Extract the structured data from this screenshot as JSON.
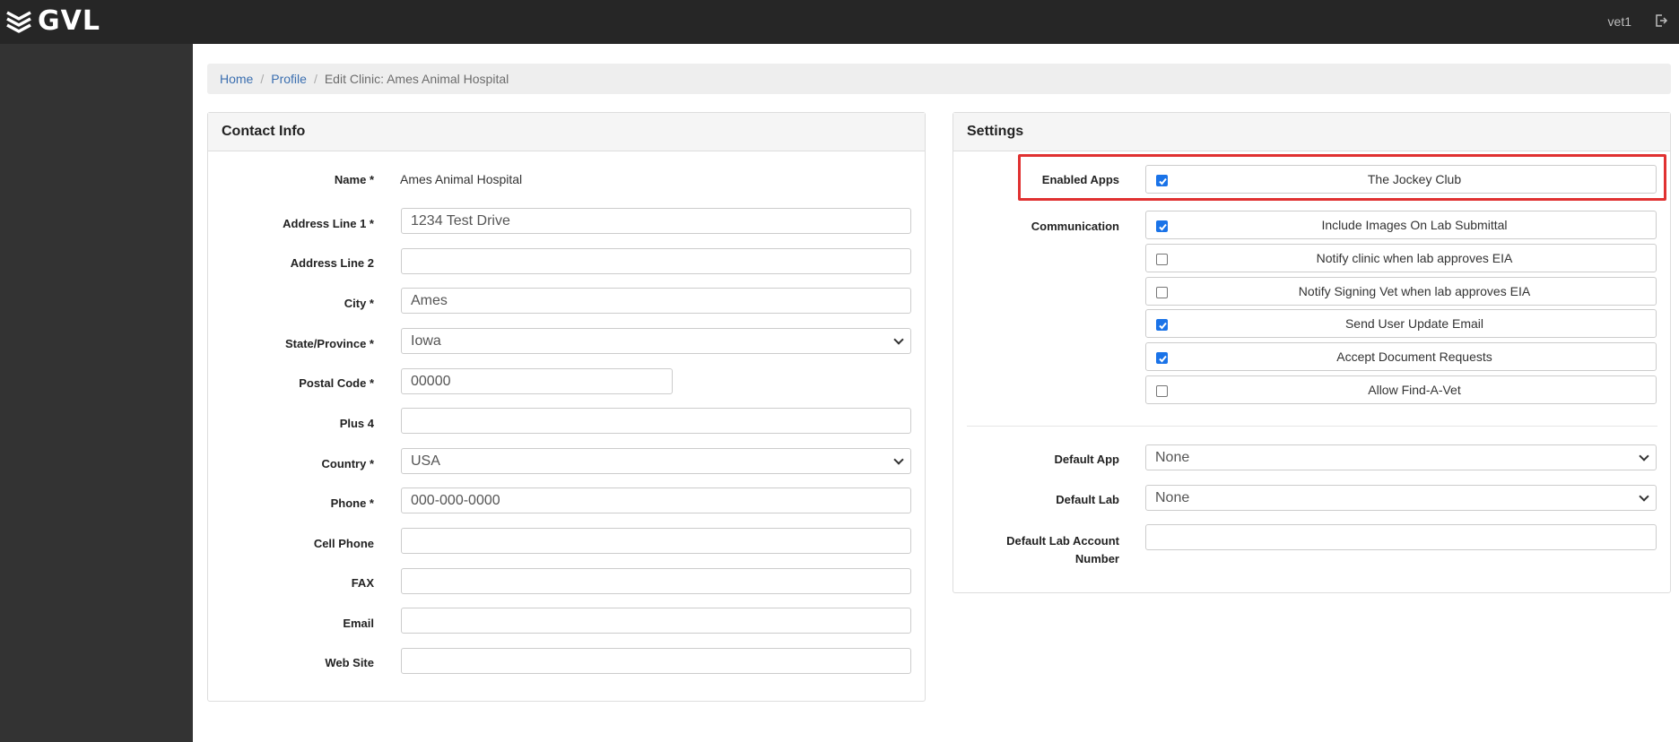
{
  "app": {
    "logo_text": "GVL",
    "user": "vet1"
  },
  "breadcrumb": {
    "home": "Home",
    "profile": "Profile",
    "current": "Edit Clinic: Ames Animal Hospital"
  },
  "contact": {
    "title": "Contact Info",
    "name_label": "Name *",
    "name_value": "Ames Animal Hospital",
    "address1_label": "Address Line 1 *",
    "address1_value": "1234 Test Drive",
    "address2_label": "Address Line 2",
    "address2_value": "",
    "city_label": "City *",
    "city_value": "Ames",
    "state_label": "State/Province *",
    "state_value": "Iowa",
    "postal_label": "Postal Code *",
    "postal_value": "00000",
    "plus4_label": "Plus 4",
    "plus4_value": "",
    "country_label": "Country *",
    "country_value": "USA",
    "phone_label": "Phone *",
    "phone_value": "000-000-0000",
    "cell_label": "Cell Phone",
    "cell_value": "",
    "fax_label": "FAX",
    "fax_value": "",
    "email_label": "Email",
    "email_value": "",
    "website_label": "Web Site",
    "website_value": ""
  },
  "settings": {
    "title": "Settings",
    "enabled_apps_label": "Enabled Apps",
    "enabled_apps": [
      {
        "label": "The Jockey Club",
        "checked": true
      }
    ],
    "communication_label": "Communication",
    "communication": [
      {
        "label": "Include Images On Lab Submittal",
        "checked": true
      },
      {
        "label": "Notify clinic when lab approves EIA",
        "checked": false
      },
      {
        "label": "Notify Signing Vet when lab approves EIA",
        "checked": false
      },
      {
        "label": "Send User Update Email",
        "checked": true
      },
      {
        "label": "Accept Document Requests",
        "checked": true
      },
      {
        "label": "Allow Find-A-Vet",
        "checked": false
      }
    ],
    "default_app_label": "Default App",
    "default_app_value": "None",
    "default_lab_label": "Default Lab",
    "default_lab_value": "None",
    "default_lab_account_label_line1": "Default Lab Account",
    "default_lab_account_label_line2": "Number",
    "default_lab_account_value": ""
  },
  "colors": {
    "accent": "#1a73e8",
    "highlight": "#e03131",
    "topbar": "#262626",
    "sidebar": "#333333"
  }
}
